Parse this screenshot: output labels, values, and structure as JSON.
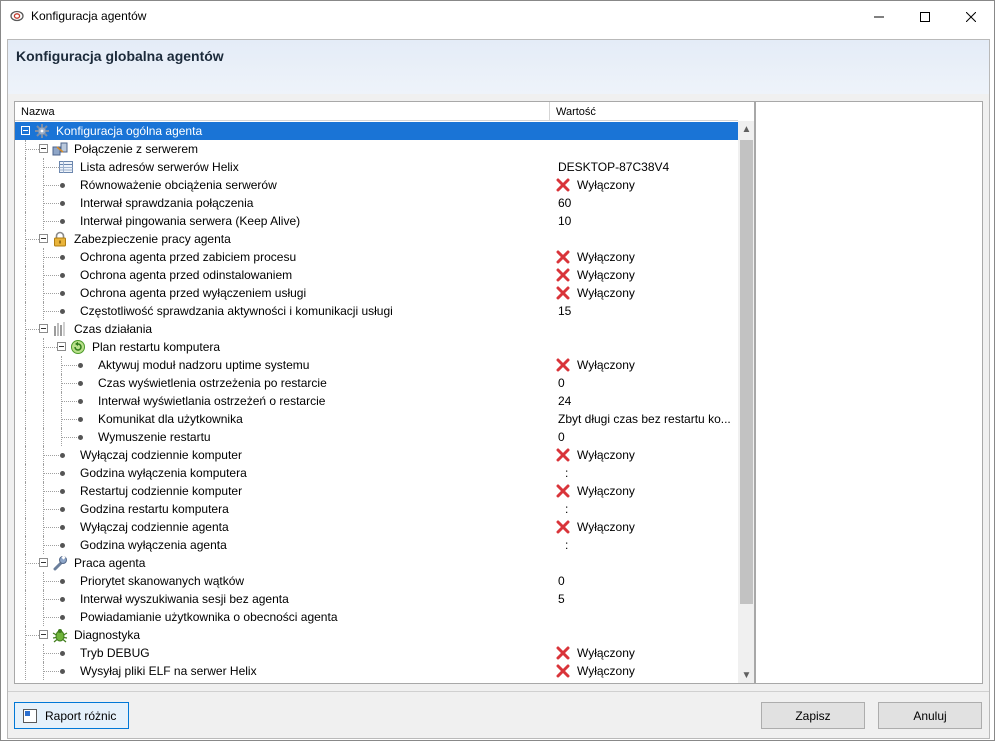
{
  "window": {
    "title": "Konfiguracja agentów",
    "controls": [
      "minimize",
      "maximize",
      "close"
    ]
  },
  "header": {
    "title": "Konfiguracja globalna agentów"
  },
  "tree": {
    "columns": {
      "name": "Nazwa",
      "value": "Wartość"
    },
    "rows": [
      {
        "label": "Konfiguracja ogólna agenta",
        "value": "",
        "disabled": false,
        "level": 0,
        "type": "group",
        "icon": "gear-icon",
        "selected": true
      },
      {
        "label": "Połączenie z serwerem",
        "value": "",
        "disabled": false,
        "level": 1,
        "type": "group",
        "icon": "network-icon"
      },
      {
        "label": "Lista adresów serwerów Helix",
        "value": "DESKTOP-87C38V4",
        "disabled": false,
        "level": 2,
        "type": "list",
        "icon": "table-icon"
      },
      {
        "label": "Równoważenie obciążenia serwerów",
        "value": "Wyłączony",
        "disabled": true,
        "level": 2,
        "type": "item"
      },
      {
        "label": "Interwał sprawdzania połączenia",
        "value": "60",
        "disabled": false,
        "level": 2,
        "type": "item"
      },
      {
        "label": "Interwał pingowania serwera (Keep Alive)",
        "value": "10",
        "disabled": false,
        "level": 2,
        "type": "item"
      },
      {
        "label": "Zabezpieczenie pracy agenta",
        "value": "",
        "disabled": false,
        "level": 1,
        "type": "group",
        "icon": "lock-icon"
      },
      {
        "label": "Ochrona agenta przed zabiciem procesu",
        "value": "Wyłączony",
        "disabled": true,
        "level": 2,
        "type": "item"
      },
      {
        "label": "Ochrona agenta przed odinstalowaniem",
        "value": "Wyłączony",
        "disabled": true,
        "level": 2,
        "type": "item"
      },
      {
        "label": "Ochrona agenta przed wyłączeniem usługi",
        "value": "Wyłączony",
        "disabled": true,
        "level": 2,
        "type": "item"
      },
      {
        "label": "Częstotliwość sprawdzania aktywności i komunikacji usługi",
        "value": "15",
        "disabled": false,
        "level": 2,
        "type": "item"
      },
      {
        "label": "Czas działania",
        "value": "",
        "disabled": false,
        "level": 1,
        "type": "group",
        "icon": "uptime-icon"
      },
      {
        "label": "Plan restartu komputera",
        "value": "",
        "disabled": false,
        "level": 2,
        "type": "group",
        "icon": "restart-icon"
      },
      {
        "label": "Aktywuj moduł nadzoru uptime systemu",
        "value": "Wyłączony",
        "disabled": true,
        "level": 3,
        "type": "item"
      },
      {
        "label": "Czas wyświetlenia ostrzeżenia po restarcie",
        "value": "0",
        "disabled": false,
        "level": 3,
        "type": "item"
      },
      {
        "label": "Interwał wyświetlania ostrzeżeń o restarcie",
        "value": "24",
        "disabled": false,
        "level": 3,
        "type": "item"
      },
      {
        "label": "Komunikat dla użytkownika",
        "value": "Zbyt długi czas bez restartu ko...",
        "disabled": false,
        "level": 3,
        "type": "item"
      },
      {
        "label": "Wymuszenie restartu",
        "value": "0",
        "disabled": false,
        "level": 3,
        "type": "item"
      },
      {
        "label": "Wyłączaj codziennie komputer",
        "value": "Wyłączony",
        "disabled": true,
        "level": 2,
        "type": "item"
      },
      {
        "label": "Godzina wyłączenia komputera",
        "value": ":",
        "disabled": false,
        "level": 2,
        "type": "item"
      },
      {
        "label": "Restartuj codziennie komputer",
        "value": "Wyłączony",
        "disabled": true,
        "level": 2,
        "type": "item"
      },
      {
        "label": "Godzina restartu komputera",
        "value": ":",
        "disabled": false,
        "level": 2,
        "type": "item"
      },
      {
        "label": "Wyłączaj codziennie agenta",
        "value": "Wyłączony",
        "disabled": true,
        "level": 2,
        "type": "item"
      },
      {
        "label": "Godzina wyłączenia agenta",
        "value": ":",
        "disabled": false,
        "level": 2,
        "type": "item"
      },
      {
        "label": "Praca agenta",
        "value": "",
        "disabled": false,
        "level": 1,
        "type": "group",
        "icon": "wrench-icon"
      },
      {
        "label": "Priorytet skanowanych wątków",
        "value": "0",
        "disabled": false,
        "level": 2,
        "type": "item"
      },
      {
        "label": "Interwał wyszukiwania sesji bez agenta",
        "value": "5",
        "disabled": false,
        "level": 2,
        "type": "item"
      },
      {
        "label": "Powiadamianie użytkownika o obecności agenta",
        "value": "",
        "disabled": false,
        "level": 2,
        "type": "item"
      },
      {
        "label": "Diagnostyka",
        "value": "",
        "disabled": false,
        "level": 1,
        "type": "group",
        "icon": "bug-icon"
      },
      {
        "label": "Tryb DEBUG",
        "value": "Wyłączony",
        "disabled": true,
        "level": 2,
        "type": "item"
      },
      {
        "label": "Wysyłaj pliki ELF na serwer Helix",
        "value": "Wyłączony",
        "disabled": true,
        "level": 2,
        "type": "item"
      }
    ]
  },
  "footer": {
    "report_label": "Raport różnic",
    "save_label": "Zapisz",
    "cancel_label": "Anuluj"
  },
  "colors": {
    "selection": "#1a74d6",
    "disabled_x": "#d9343a",
    "header_band": "#e4ecf7"
  }
}
